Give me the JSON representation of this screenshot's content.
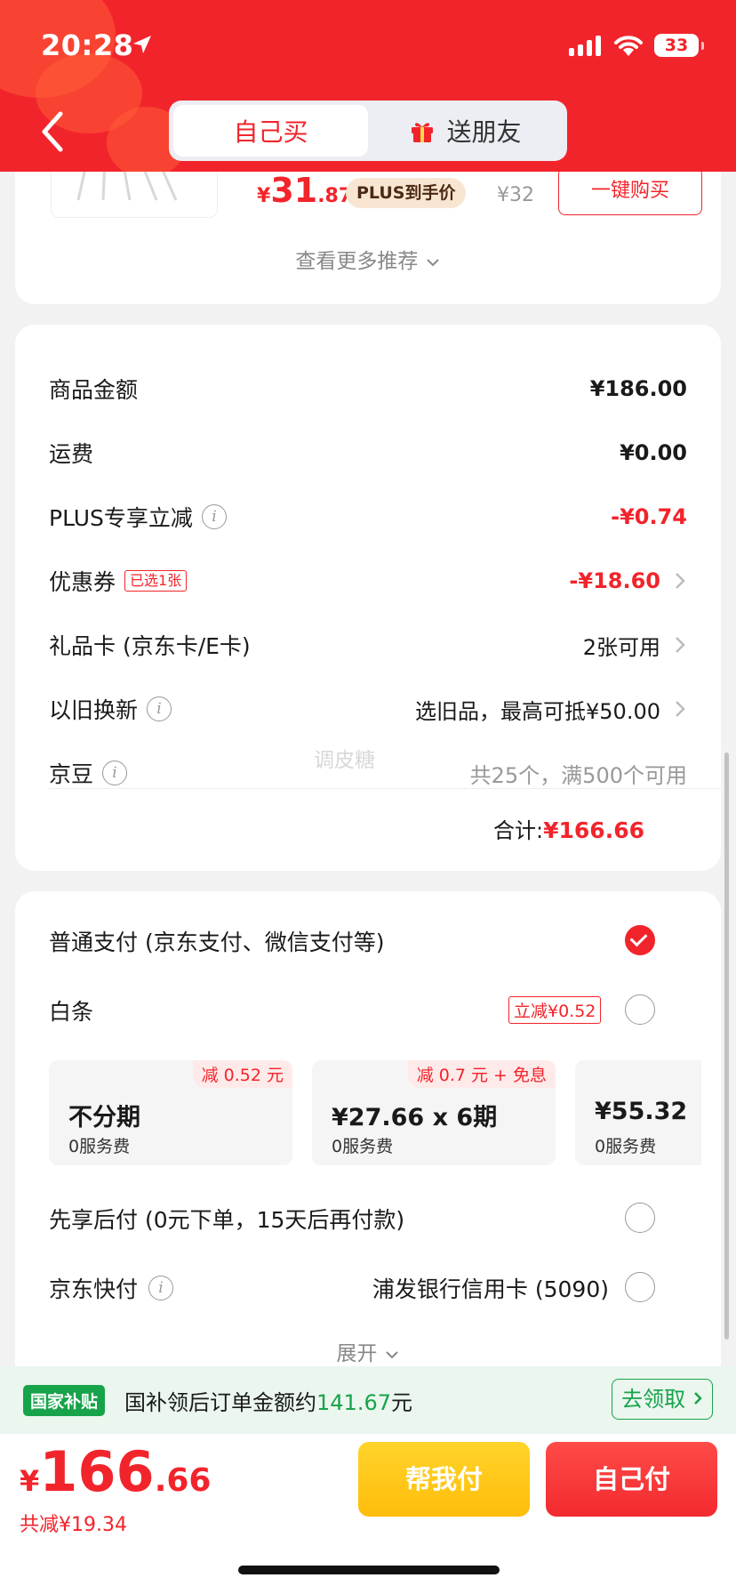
{
  "status_bar": {
    "time": "20:28",
    "battery": "33"
  },
  "header": {
    "tabs": [
      {
        "label": "自己买",
        "active": true
      },
      {
        "label": "送朋友",
        "active": false,
        "icon": "gift-icon"
      }
    ],
    "accent": "#f2242b"
  },
  "recommend": {
    "price_currency": "¥",
    "price_int": "31",
    "price_dec": ".87",
    "plus_badge": "PLUS到手价",
    "old_price": "¥32",
    "buy_button": "一键购买",
    "more_label": "查看更多推荐"
  },
  "summary": {
    "rows": [
      {
        "label": "商品金额",
        "value": "¥186.00"
      },
      {
        "label": "运费",
        "value": "¥0.00"
      },
      {
        "label": "PLUS专享立减",
        "value": "-¥0.74"
      },
      {
        "label": "优惠券",
        "badge": "已选1张",
        "value": "-¥18.60"
      },
      {
        "label": "礼品卡 (京东卡/E卡)",
        "value": "2张可用"
      },
      {
        "label": "以旧换新",
        "value": "选旧品，最高可抵¥50.00"
      },
      {
        "label": "京豆",
        "value": "共25个，满500个可用"
      }
    ],
    "watermark": "调皮糖",
    "total_label": "合计:",
    "total_value": "¥166.66"
  },
  "payment": {
    "normal": "普通支付 (京东支付、微信支付等)",
    "baitiao": "白条",
    "baitiao_badge": "立减¥0.52",
    "plans": [
      {
        "tag": "减 0.52 元",
        "title": "不分期",
        "fee": "0服务费"
      },
      {
        "tag": "减 0.7 元 + 免息",
        "title": "¥27.66 x 6期",
        "fee": "0服务费"
      },
      {
        "tag": "",
        "title": "¥55.32",
        "fee": "0服务费"
      }
    ],
    "pay_later": "先享后付 (0元下单，15天后再付款)",
    "quick_pay": "京东快付",
    "bank": "浦发银行信用卡 (5090)",
    "expand": "展开"
  },
  "subsidy": {
    "badge": "国家补贴",
    "text_prefix": "国补领后订单金额约",
    "amount": "141.67",
    "text_suffix": "元",
    "claim": "去领取"
  },
  "bottom": {
    "currency": "¥",
    "price_int": "166",
    "price_dec": ".66",
    "saved": "共减¥19.34",
    "help_pay": "帮我付",
    "self_pay": "自己付"
  }
}
